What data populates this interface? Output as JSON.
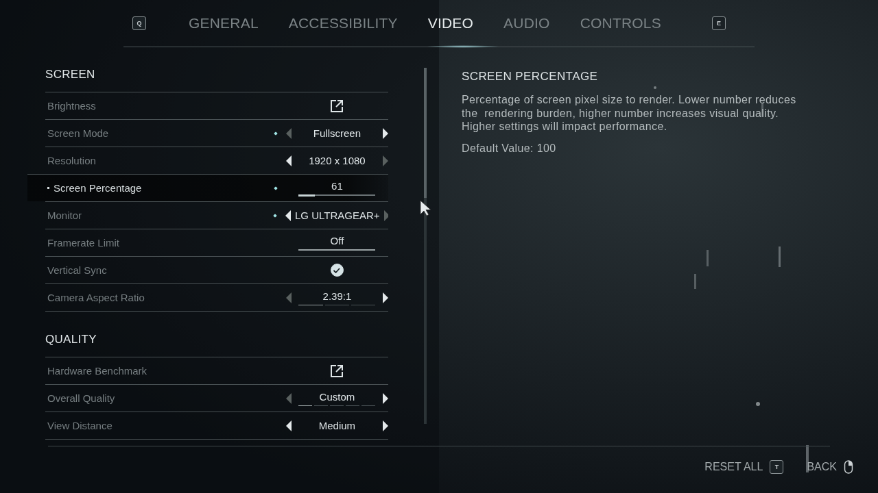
{
  "tabs": {
    "prev_key": "Q",
    "next_key": "E",
    "items": [
      {
        "label": "GENERAL",
        "selected": false
      },
      {
        "label": "ACCESSIBILITY",
        "selected": false
      },
      {
        "label": "VIDEO",
        "selected": true
      },
      {
        "label": "AUDIO",
        "selected": false
      },
      {
        "label": "CONTROLS",
        "selected": false
      }
    ]
  },
  "sections": [
    {
      "title": "SCREEN",
      "rows": [
        {
          "label": "Brightness",
          "kind": "link",
          "modified": false,
          "selected": false
        },
        {
          "label": "Screen Mode",
          "kind": "selector",
          "value": "Fullscreen",
          "modified": true,
          "selected": false,
          "left_enabled": false,
          "right_enabled": true
        },
        {
          "label": "Resolution",
          "kind": "selector",
          "value": "1920 x 1080",
          "modified": false,
          "selected": false,
          "left_enabled": true,
          "right_enabled": false
        },
        {
          "label": "Screen Percentage",
          "kind": "slider",
          "value": "61",
          "level": 0.21,
          "modified": true,
          "selected": true
        },
        {
          "label": "Monitor",
          "kind": "selector",
          "value": "LG ULTRAGEAR+",
          "modified": true,
          "selected": false,
          "left_enabled": true,
          "right_enabled": false
        },
        {
          "label": "Framerate Limit",
          "kind": "dropdown",
          "value": "Off",
          "modified": false,
          "selected": false
        },
        {
          "label": "Vertical Sync",
          "kind": "checkbox",
          "checked": true,
          "modified": false,
          "selected": false
        },
        {
          "label": "Camera Aspect Ratio",
          "kind": "selector",
          "value": "2.39:1",
          "modified": false,
          "selected": false,
          "left_enabled": false,
          "right_enabled": true,
          "segments": [
            {
              "selected": true
            },
            {
              "selected": false
            },
            {
              "selected": false
            }
          ]
        }
      ]
    },
    {
      "title": "QUALITY",
      "rows": [
        {
          "label": "Hardware Benchmark",
          "kind": "link",
          "modified": false,
          "selected": false
        },
        {
          "label": "Overall Quality",
          "kind": "selector",
          "value": "Custom",
          "modified": false,
          "selected": false,
          "left_enabled": false,
          "right_enabled": true,
          "segments": [
            {
              "selected": true
            },
            {
              "selected": false
            },
            {
              "selected": false
            },
            {
              "selected": false
            },
            {
              "selected": false
            }
          ]
        },
        {
          "label": "View Distance",
          "kind": "selector",
          "value": "Medium",
          "modified": false,
          "selected": false,
          "left_enabled": true,
          "right_enabled": true
        }
      ]
    }
  ],
  "description": {
    "title": "SCREEN PERCENTAGE",
    "text": "Percentage of screen pixel size to render. Lower number reduces the  rendering burden, higher number increases visual quality. Higher settings will impact performance.",
    "default": "Default Value: 100"
  },
  "footer": {
    "reset_label": "RESET ALL",
    "reset_key": "T",
    "back_label": "BACK"
  }
}
